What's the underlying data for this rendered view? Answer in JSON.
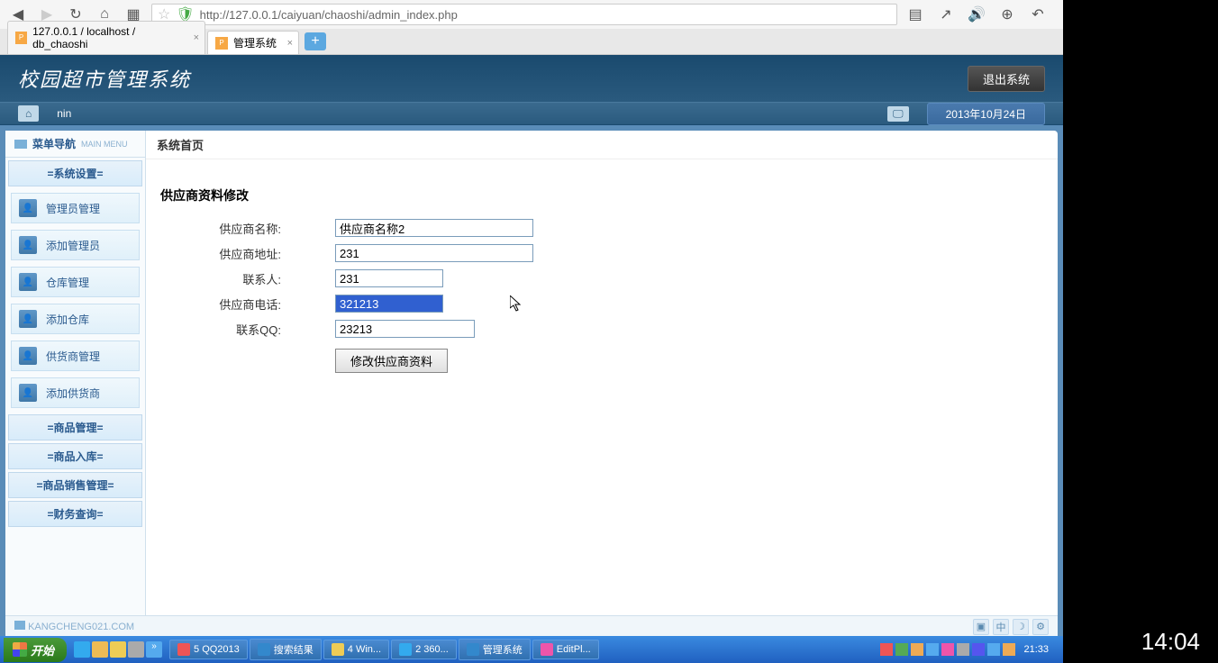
{
  "browser": {
    "url": "http://127.0.0.1/caiyuan/chaoshi/admin_index.php",
    "tabs": [
      {
        "label": "127.0.0.1 / localhost / db_chaoshi"
      },
      {
        "label": "管理系统"
      }
    ]
  },
  "app": {
    "title": "校园超市管理系统",
    "logout": "退出系统",
    "sub_user": "nin",
    "date": "2013年10月24日"
  },
  "sidebar": {
    "header": "菜单导航",
    "header_sub": "MAIN MENU",
    "sections": {
      "system": "=系统设置=",
      "goods_manage": "=商品管理=",
      "goods_in": "=商品入库=",
      "goods_sale": "=商品销售管理=",
      "finance": "=财务查询="
    },
    "items": {
      "admin_manage": "管理员管理",
      "add_admin": "添加管理员",
      "warehouse_manage": "仓库管理",
      "add_warehouse": "添加仓库",
      "supplier_manage": "供货商管理",
      "add_supplier": "添加供货商"
    }
  },
  "main": {
    "breadcrumb": "系统首页",
    "form_title": "供应商资料修改",
    "labels": {
      "name": "供应商名称:",
      "address": "供应商地址:",
      "contact": "联系人:",
      "phone": "供应商电话:",
      "qq": "联系QQ:"
    },
    "values": {
      "name": "供应商名称2",
      "address": "231",
      "contact": "231",
      "phone": "321213",
      "qq": "23213"
    },
    "submit": "修改供应商资料"
  },
  "footer": {
    "credit": "KANGCHENG021.COM",
    "ime": "中"
  },
  "taskbar": {
    "start": "开始",
    "items": [
      "5 QQ2013",
      "搜索结果",
      "4 Win...",
      "2 360...",
      "管理系统",
      "EditPl..."
    ],
    "clock": "21:33"
  },
  "video_time": "14:04"
}
